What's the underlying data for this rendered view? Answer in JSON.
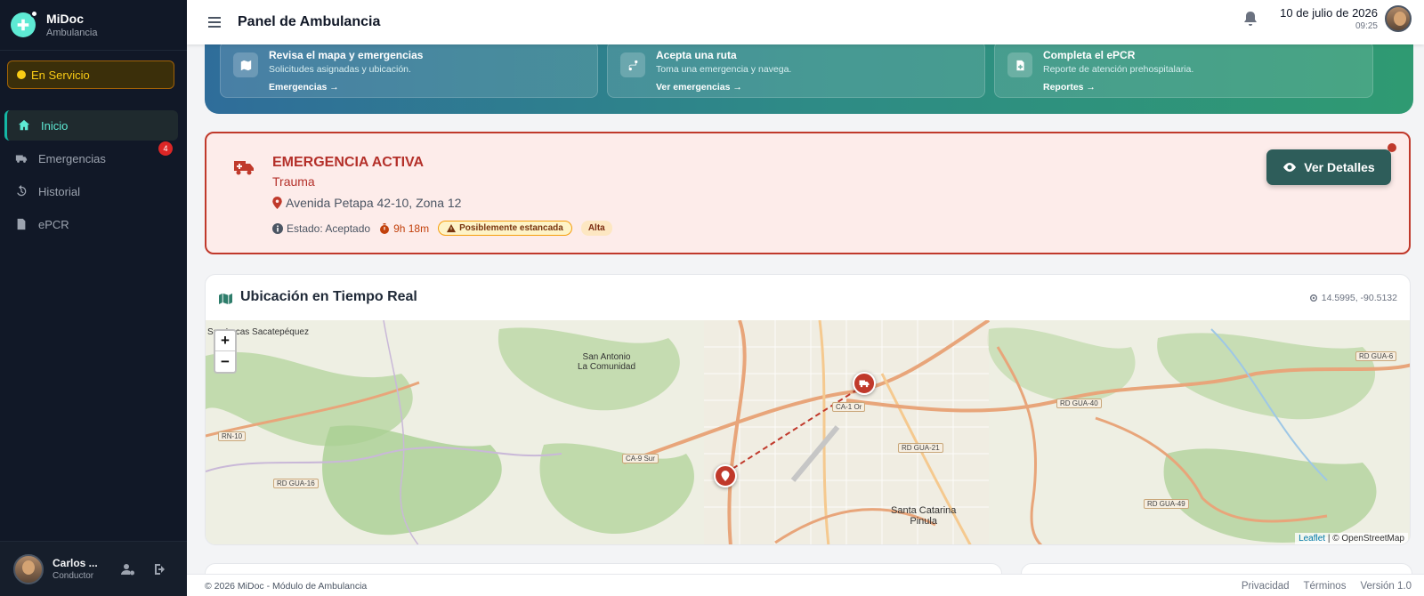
{
  "brand": {
    "name": "MiDoc",
    "subtitle": "Ambulancia"
  },
  "status": {
    "label": "En Servicio",
    "color": "#facc15"
  },
  "nav": [
    {
      "label": "Inicio",
      "icon": "home-icon",
      "active": true
    },
    {
      "label": "Emergencias",
      "icon": "truck-icon",
      "badge": "4"
    },
    {
      "label": "Historial",
      "icon": "history-icon"
    },
    {
      "label": "ePCR",
      "icon": "file-icon"
    }
  ],
  "user": {
    "name": "Carlos ...",
    "role": "Conductor"
  },
  "topbar": {
    "title": "Panel de Ambulancia",
    "date": "10 de julio de 2026",
    "time": "09:25"
  },
  "hero_cards": [
    {
      "heading": "Revisa el mapa y emergencias",
      "sub": "Solicitudes asignadas y ubicación.",
      "link": "Emergencias →",
      "icon": "map-icon"
    },
    {
      "heading": "Acepta una ruta",
      "sub": "Toma una emergencia y navega.",
      "link": "Ver emergencias →",
      "icon": "route-icon"
    },
    {
      "heading": "Completa el ePCR",
      "sub": "Reporte de atención prehospitalaria.",
      "link": "Reportes →",
      "icon": "file-medical-icon"
    }
  ],
  "emergency": {
    "heading": "EMERGENCIA ACTIVA",
    "type": "Trauma",
    "address": "Avenida Petapa 42-10, Zona 12",
    "status": "Estado: Aceptado",
    "elapsed": "9h 18m",
    "warning": "Posiblemente estancada",
    "priority": "Alta",
    "button": "Ver Detalles",
    "accent": "#c0392b"
  },
  "map": {
    "title": "Ubicación en Tiempo Real",
    "coords": "14.5995, -90.5132",
    "attribution_leaflet": "Leaflet",
    "attribution_osm": "| © OpenStreetMap",
    "zoom_in": "+",
    "zoom_out": "−",
    "labels": {
      "sacatepequez": "San Lucas Sacatepéquez",
      "san_antonio": "San Antonio\nLa Comunidad",
      "santa_catarina": "Santa Catarina\nPinula"
    },
    "roads": [
      "RD GUA-6",
      "RD GUA-40",
      "RD GUA-21",
      "RD GUA-16",
      "RN-10",
      "CA-9 Sur",
      "CA-1 Or",
      "RD GUA-49"
    ]
  },
  "footer": {
    "copyright": "© 2026 MiDoc - Módulo de Ambulancia",
    "privacy": "Privacidad",
    "terms": "Términos",
    "version": "Versión 1.0"
  }
}
